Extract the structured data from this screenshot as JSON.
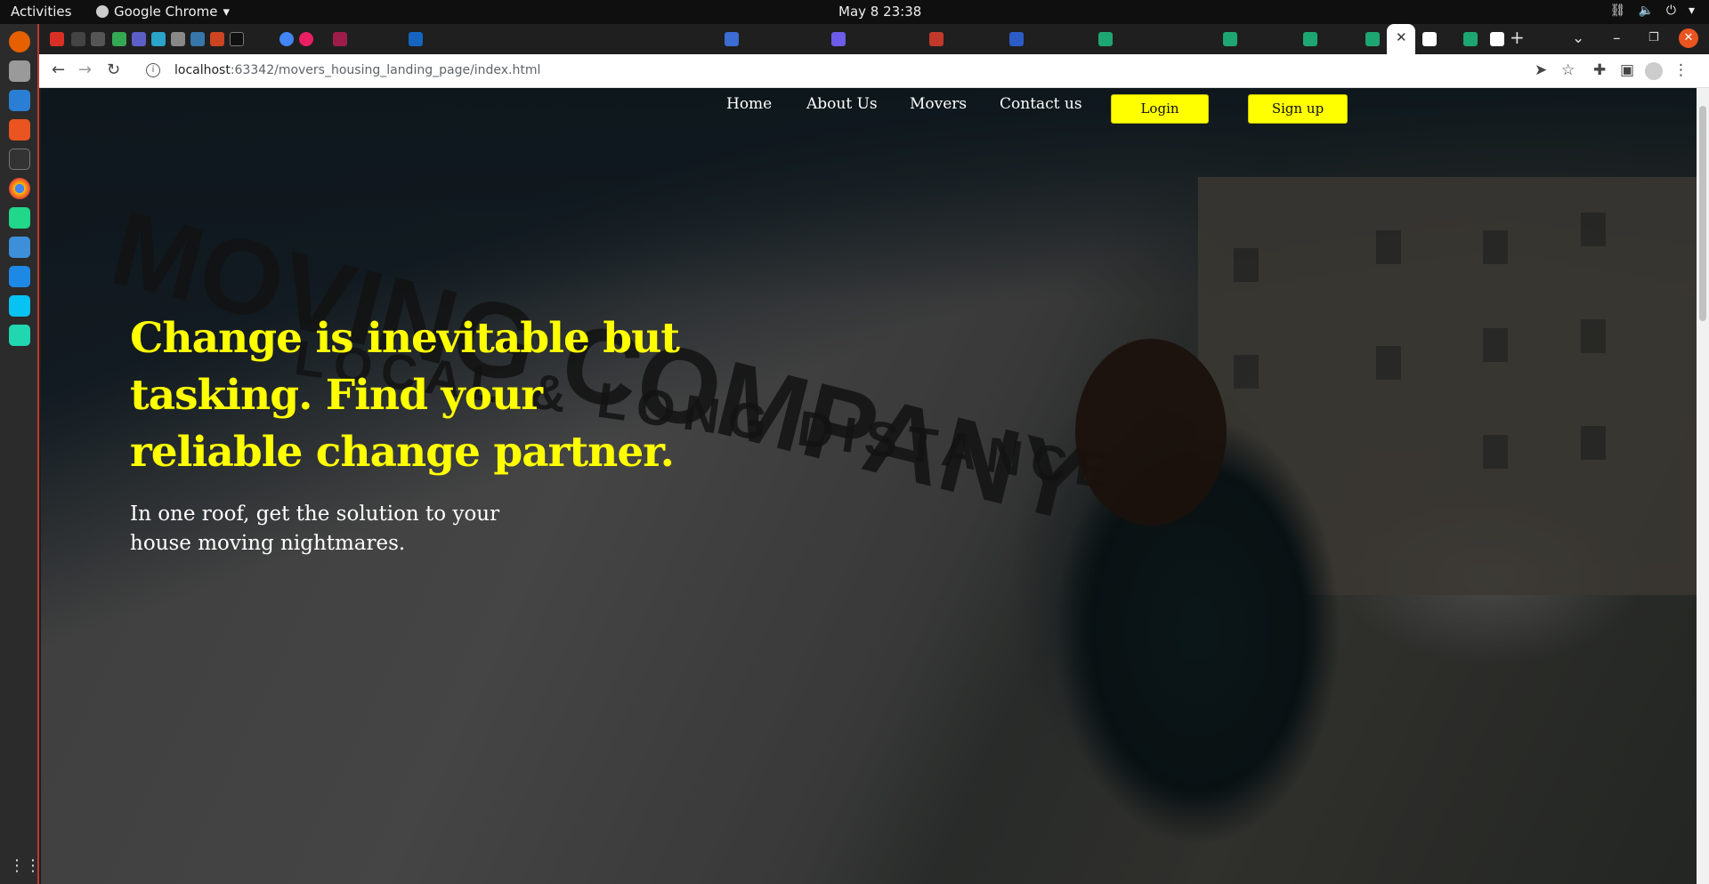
{
  "topbar": {
    "activities": "Activities",
    "app_name": "Google Chrome",
    "clock": "May 8  23:38",
    "icons": [
      "network-icon",
      "volume-icon",
      "power-icon"
    ]
  },
  "dock": {
    "items": [
      "firefox-icon",
      "files-icon",
      "text-editor-icon",
      "app-center-icon",
      "terminal-icon",
      "chrome-icon",
      "pycharm-icon",
      "notes-icon",
      "vscode-icon",
      "webstorm-icon",
      "pycharm-ce-icon"
    ],
    "apps_grid": "show-apps-icon"
  },
  "browser": {
    "active_tab_close": "✕",
    "new_tab": "+",
    "url_host": "localhost",
    "url_rest": ":63342/movers_housing_landing_page/index.html"
  },
  "site": {
    "nav": {
      "home": "Home",
      "about": "About Us",
      "movers": "Movers",
      "contact": "Contact us",
      "login": "Login",
      "signup": "Sign up"
    },
    "hero": {
      "title": "Change is inevitable but tasking. Find your reliable change partner.",
      "subtitle": "In one roof, get the solution to your house moving nightmares.",
      "van_text_1": "MOVING COMPANY",
      "van_text_2": "LOCAL & LONG DISTANCE"
    }
  },
  "colors": {
    "accent_yellow": "#ffff00",
    "topbar": "#0f0f0f",
    "dock": "#2b2b2b"
  }
}
